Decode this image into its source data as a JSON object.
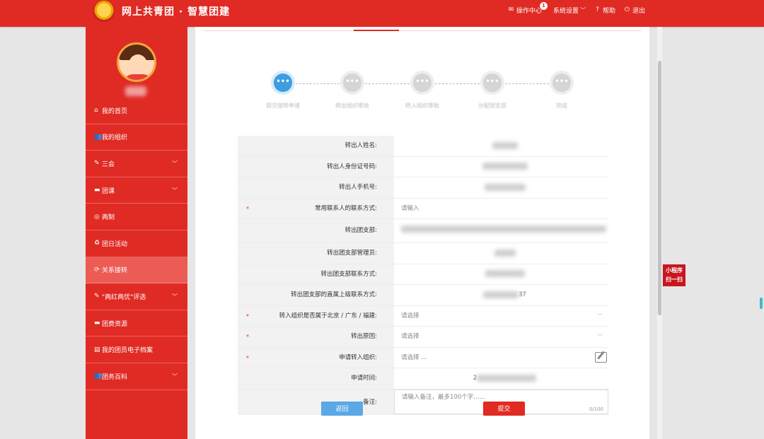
{
  "header": {
    "brand_title": "网上共青团 · 智慧团建",
    "nav": [
      {
        "label": "操作中心",
        "icon": "mail-icon",
        "badge": "1"
      },
      {
        "label": "系统设置",
        "icon": "",
        "chevron": "﹀"
      },
      {
        "label": "帮助",
        "icon": "help-icon"
      },
      {
        "label": "退出",
        "icon": "logout-icon"
      }
    ]
  },
  "sidebar": {
    "items": [
      {
        "label": "我的首页",
        "icon": "home-icon",
        "glyph": "⌂",
        "chevron": ""
      },
      {
        "label": "我的组织",
        "icon": "group-icon",
        "glyph": "👥",
        "chevron": ""
      },
      {
        "label": "三会",
        "icon": "edit-icon",
        "glyph": "✎",
        "chevron": "﹀"
      },
      {
        "label": "团课",
        "icon": "folder-icon",
        "glyph": "▬",
        "chevron": "﹀"
      },
      {
        "label": "两制",
        "icon": "target-icon",
        "glyph": "◎",
        "chevron": ""
      },
      {
        "label": "团日活动",
        "icon": "recycle-icon",
        "glyph": "♻",
        "chevron": ""
      },
      {
        "label": "关系接转",
        "icon": "refresh-icon",
        "glyph": "⟳",
        "chevron": "",
        "active": true
      },
      {
        "label": "\"两红两优\"评选",
        "icon": "edit-icon",
        "glyph": "✎",
        "chevron": "﹀"
      },
      {
        "label": "团费资源",
        "icon": "folder-icon",
        "glyph": "▬",
        "chevron": ""
      },
      {
        "label": "我的团员电子档案",
        "icon": "document-icon",
        "glyph": "▤",
        "chevron": ""
      },
      {
        "label": "团务百科",
        "icon": "group-icon",
        "glyph": "👥",
        "chevron": "﹀"
      }
    ]
  },
  "steps": [
    {
      "label": "提交接转申请",
      "glyph": "•••",
      "active": true
    },
    {
      "label": "转出组织审批",
      "glyph": "•••",
      "active": false
    },
    {
      "label": "转入组织审批",
      "glyph": "•••",
      "active": false
    },
    {
      "label": "分配团支部",
      "glyph": "•••",
      "active": false
    },
    {
      "label": "完成",
      "glyph": "•••",
      "active": false
    }
  ],
  "form": {
    "rows": [
      {
        "label": "转出人姓名:",
        "required": false,
        "kind": "blur"
      },
      {
        "label": "转出人身份证号码:",
        "required": false,
        "kind": "blur"
      },
      {
        "label": "转出人手机号:",
        "required": false,
        "kind": "blur"
      },
      {
        "label": "常用联系人的联系方式:",
        "required": true,
        "kind": "input",
        "placeholder": "请输入"
      },
      {
        "label": "转出团支部:",
        "required": false,
        "kind": "blur-wide"
      },
      {
        "label": "转出团支部管理员:",
        "required": false,
        "kind": "blur"
      },
      {
        "label": "转出团支部联系方式:",
        "required": false,
        "kind": "blur"
      },
      {
        "label": "转出团支部的直属上级联系方式:",
        "required": false,
        "kind": "blur",
        "visible_suffix": "37"
      },
      {
        "label": "转入组织是否属于北京 / 广东 / 福建:",
        "required": true,
        "kind": "select",
        "placeholder": "请选择"
      },
      {
        "label": "转出原因:",
        "required": true,
        "kind": "select",
        "placeholder": "请选择"
      },
      {
        "label": "申请转入组织:",
        "required": true,
        "kind": "picker",
        "placeholder": "请选择 ..."
      },
      {
        "label": "申请时间:",
        "required": false,
        "kind": "blur",
        "visible_prefix": "2"
      },
      {
        "label": "备注:",
        "required": false,
        "kind": "textarea",
        "placeholder": "请输入备注，最多100个字……",
        "counter": "0/100"
      }
    ],
    "required_mark": "*",
    "arrow": "﹀"
  },
  "buttons": {
    "back": "返回",
    "submit": "提交"
  },
  "mini_program": {
    "line1": "小程序",
    "line2": "扫一扫"
  },
  "colors": {
    "brand_red": "#e02a24",
    "active_step": "#3d9de0",
    "back_button": "#5aa8e6"
  }
}
